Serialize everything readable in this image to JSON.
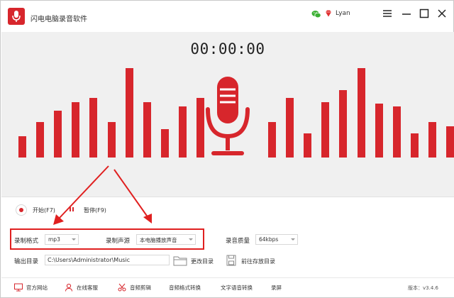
{
  "app": {
    "title": "闪电电脑录音软件",
    "username": "Lyan"
  },
  "colors": {
    "accent": "#d7262c",
    "annotation": "#e02020",
    "viz_background": "#f0f0f0"
  },
  "icons": {
    "logo": "microphone-logo",
    "wechat": "wechat-icon",
    "vip": "diamond-icon"
  },
  "timer": "00:00:00",
  "visualizer_levels_left": [
    0.24,
    0.4,
    0.52,
    0.62,
    0.67,
    0.4,
    1.0,
    0.62,
    0.32,
    0.57,
    0.67
  ],
  "visualizer_levels_right": [
    0.4,
    0.67,
    0.27,
    0.62,
    0.75,
    1.0,
    0.6,
    0.57,
    0.27,
    0.4,
    0.35,
    0.24
  ],
  "controls": {
    "start": "开始(F7)",
    "pause": "暂停(F9)"
  },
  "settings": {
    "format_label": "录制格式",
    "format_value": "mp3",
    "source_label": "录制声源",
    "source_value": "本电脑播放声音",
    "quality_label": "录音质量",
    "quality_value": "64kbps",
    "output_label": "输出目录",
    "output_path": "C:\\Users\\Administrator\\Music",
    "change_dir": "更改目录",
    "open_dir": "前往存放目录"
  },
  "bottom_nav": [
    {
      "label": "官方网站",
      "icon": "monitor-icon"
    },
    {
      "label": "在线客服",
      "icon": "headset-icon"
    },
    {
      "label": "音频剪辑",
      "icon": "scissors-icon"
    },
    {
      "label": "音频格式转换",
      "icon": ""
    },
    {
      "label": "文字语音转换",
      "icon": ""
    },
    {
      "label": "录屏",
      "icon": ""
    }
  ],
  "version": "版本：v3.4.6"
}
